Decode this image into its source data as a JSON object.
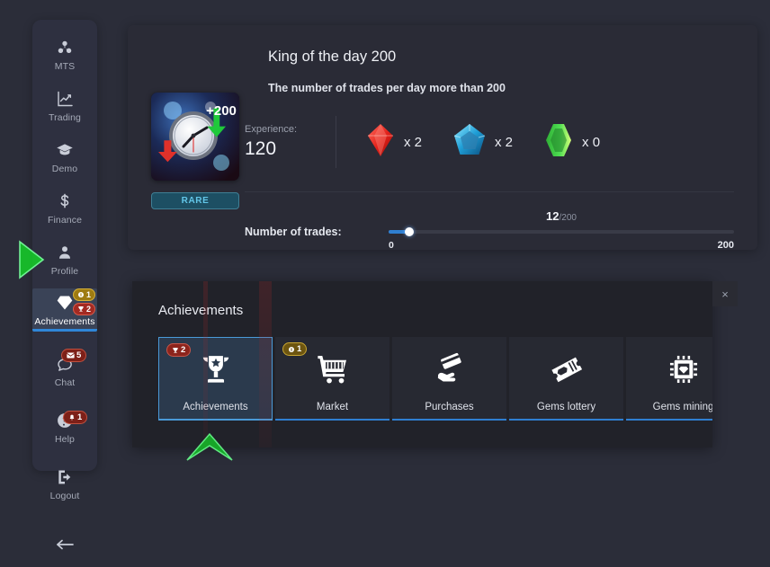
{
  "sidebar": {
    "items": [
      {
        "label": "MTS",
        "icon": "atom-icon",
        "active": false
      },
      {
        "label": "Trading",
        "icon": "chart-icon",
        "active": false
      },
      {
        "label": "Demo",
        "icon": "graduation-cap-icon",
        "active": false
      },
      {
        "label": "Finance",
        "icon": "dollar-icon",
        "active": false
      },
      {
        "label": "Profile",
        "icon": "user-icon",
        "active": false
      },
      {
        "label": "Achievements",
        "icon": "diamond-icon",
        "active": true
      },
      {
        "label": "Chat",
        "icon": "chat-bubble-icon",
        "active": false
      },
      {
        "label": "Help",
        "icon": "question-mark-icon",
        "active": false
      },
      {
        "label": "Logout",
        "icon": "logout-icon",
        "active": false
      }
    ],
    "achievements_badges": [
      {
        "icon": "coin-icon",
        "count": "1",
        "color": "#d6b13a"
      },
      {
        "icon": "trophy-icon",
        "count": "2",
        "color": "#d85a4a"
      }
    ],
    "chat_badge": {
      "icon": "envelope-icon",
      "count": "5"
    },
    "help_badge": {
      "icon": "bell-icon",
      "count": "1"
    },
    "collapse_icon": "arrow-left-icon"
  },
  "achievement": {
    "title": "King of the day 200",
    "subtitle": "The number of trades per day more than 200",
    "rarity": "RARE",
    "badge_bonus": "+200",
    "experience_label": "Experience:",
    "experience_value": "120",
    "rewards": [
      {
        "gem": "red-diamond-gem",
        "color": "#e8342b",
        "amount": "x 2"
      },
      {
        "gem": "blue-pentagon-gem",
        "color": "#2fb9e8",
        "amount": "x 2"
      },
      {
        "gem": "green-hexagon-gem",
        "color": "#3fd44a",
        "amount": "x 0"
      }
    ],
    "progress": {
      "label": "Number of trades:",
      "current": "12",
      "total": "/200",
      "min_tick": "0",
      "max_tick": "200",
      "percent": 6
    }
  },
  "bottom_panel": {
    "title": "Achievements",
    "close_label": "×",
    "tabs": [
      {
        "label": "Achievements",
        "icon": "trophy-icon",
        "selected": true,
        "badge": {
          "icon": "trophy-icon",
          "count": "2",
          "style": "red"
        }
      },
      {
        "label": "Market",
        "icon": "shopping-cart-icon",
        "selected": false,
        "badge": {
          "icon": "coin-icon",
          "count": "1",
          "style": "gold"
        }
      },
      {
        "label": "Purchases",
        "icon": "hand-card-icon",
        "selected": false,
        "badge": null
      },
      {
        "label": "Gems lottery",
        "icon": "ticket-gem-icon",
        "selected": false,
        "badge": null
      },
      {
        "label": "Gems mining",
        "icon": "chip-diamond-icon",
        "selected": false,
        "badge": null
      }
    ]
  },
  "overlay": {
    "cursor_arrow_side": "green-arrow-right",
    "cursor_arrow_bottom": "green-arrow-up"
  },
  "colors": {
    "page_bg": "#2b2d39",
    "card_bg": "#2a2b36",
    "panel_bg": "#212229",
    "sidebar_bg": "#2e3040",
    "accent_blue": "#2f7fd1",
    "rare_teal": "#63c6e8"
  }
}
